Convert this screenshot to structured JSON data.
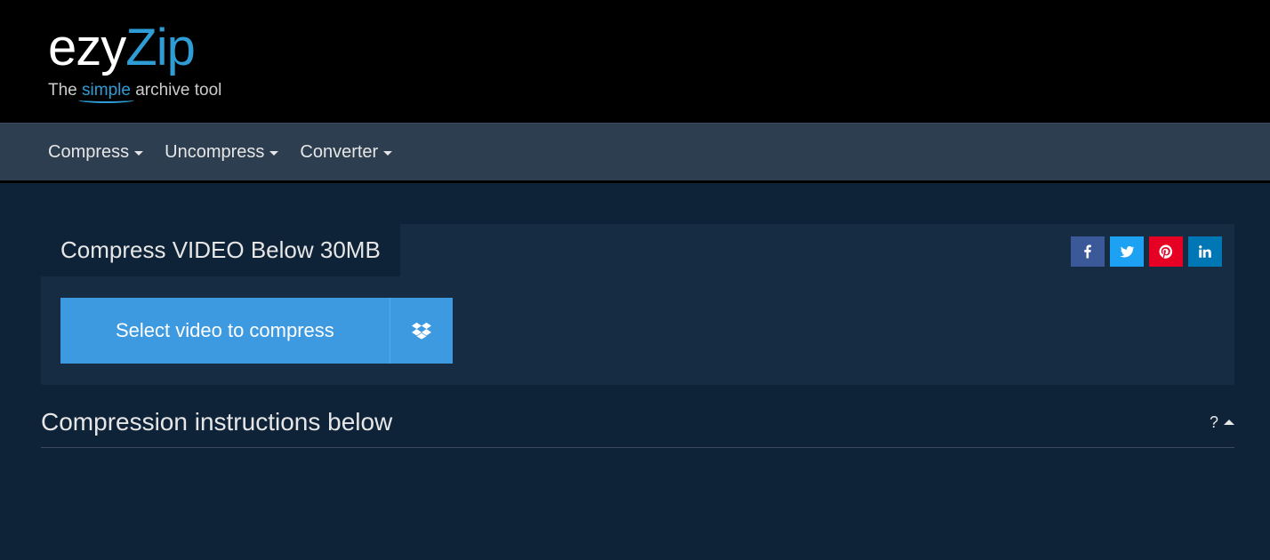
{
  "brand": {
    "logo_part1": "ezy",
    "logo_part2": "Zip",
    "tagline_prefix": "The ",
    "tagline_highlight": "simple",
    "tagline_suffix": " archive tool"
  },
  "nav": {
    "items": [
      {
        "label": "Compress"
      },
      {
        "label": "Uncompress"
      },
      {
        "label": "Converter"
      }
    ]
  },
  "panel": {
    "tab_title": "Compress VIDEO Below 30MB",
    "select_button": "Select video to compress"
  },
  "instructions": {
    "title": "Compression instructions below",
    "help_label": "?"
  },
  "social": {
    "facebook": "facebook",
    "twitter": "twitter",
    "pinterest": "pinterest",
    "linkedin": "linkedin"
  }
}
